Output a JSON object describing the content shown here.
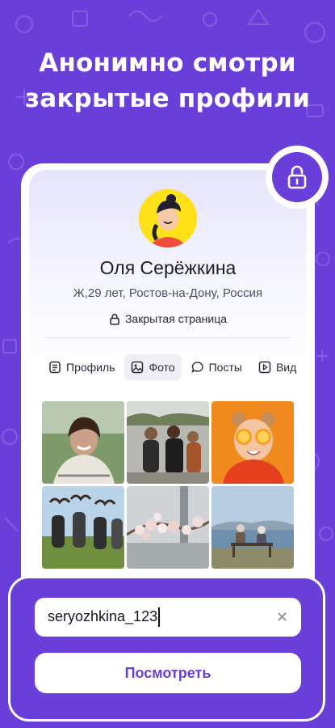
{
  "headline": {
    "line1": "Анонимно смотри",
    "line2": "закрытые профили"
  },
  "profile": {
    "name": "Оля Серёжкина",
    "meta": "Ж,29 лет, Ростов-на-Дону, Россия",
    "status": "Закрытая страница"
  },
  "tabs": [
    {
      "label": "Профиль",
      "icon": "document-icon",
      "active": false
    },
    {
      "label": "Фото",
      "icon": "image-icon",
      "active": true
    },
    {
      "label": "Посты",
      "icon": "chat-bubble-icon",
      "active": false
    },
    {
      "label": "Вид",
      "icon": "video-icon",
      "active": false
    }
  ],
  "photos": [
    {
      "subject": "smiling-woman-greenhouse"
    },
    {
      "subject": "friends-walking-street"
    },
    {
      "subject": "girl-with-orange-slices"
    },
    {
      "subject": "girls-heart-hands-field"
    },
    {
      "subject": "blossom-branch-city"
    },
    {
      "subject": "couple-on-bench-lake"
    }
  ],
  "search": {
    "value": "seryozhkina_123",
    "clear_icon": "close-icon"
  },
  "submit": {
    "label": "Посмотреть"
  },
  "colors": {
    "accent": "#6a3fd9",
    "avatar_bg": "#ffe119"
  }
}
